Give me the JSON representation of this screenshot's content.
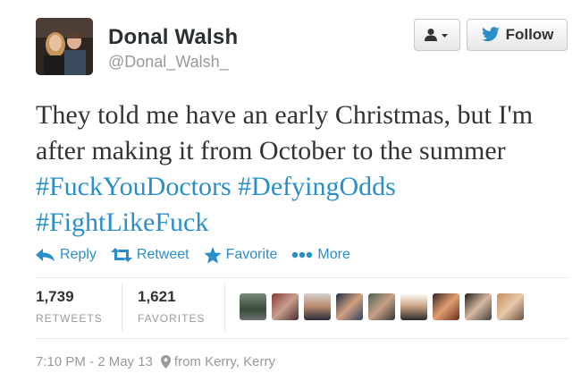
{
  "user": {
    "name": "Donal Walsh",
    "handle": "@Donal_Walsh_"
  },
  "buttons": {
    "follow_label": "Follow",
    "user_icon": "user-dropdown-icon"
  },
  "tweet": {
    "text_plain": "They told me have an early Christmas, but I'm after making it from October to the summer ",
    "hashtags": [
      "#FuckYouDoctors",
      "#DefyingOdds",
      "#FightLikeFuck"
    ]
  },
  "actions": [
    {
      "label": "Reply",
      "icon": "reply-icon"
    },
    {
      "label": "Retweet",
      "icon": "retweet-icon"
    },
    {
      "label": "Favorite",
      "icon": "star-icon"
    },
    {
      "label": "More",
      "icon": "more-dots-icon"
    }
  ],
  "stats": {
    "retweets_count": "1,739",
    "retweets_label": "RETWEETS",
    "favorites_count": "1,621",
    "favorites_label": "FAVORITES"
  },
  "favoriters_count_shown": 9,
  "meta": {
    "time": "7:10 PM - 2 May 13",
    "location": "from Kerry, Kerry"
  },
  "colors": {
    "link": "#2a8ec8",
    "muted": "#999999",
    "text": "#333333"
  }
}
